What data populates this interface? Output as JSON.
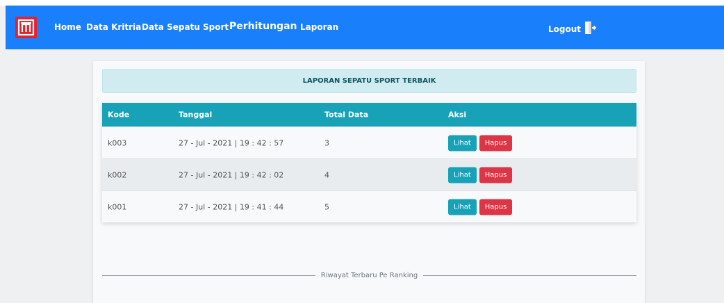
{
  "nav": {
    "home": "Home",
    "kriteria": "Data Kritria",
    "sepatu": "Data Sepatu Sport",
    "perhitungan": "Perhitungan",
    "laporan": "Laporan",
    "logout": "Logout"
  },
  "report": {
    "title": "LAPORAN SEPATU SPORT TERBAIK",
    "columns": [
      "Kode",
      "Tanggal",
      "Total Data",
      "Aksi"
    ],
    "rows": [
      {
        "kode": "k003",
        "tanggal": "27 - Jul - 2021 | 19 : 42 : 57",
        "total": "3",
        "lihat": "Lihat",
        "hapus": "Hapus"
      },
      {
        "kode": "k002",
        "tanggal": "27 - Jul - 2021 | 19 : 42 : 02",
        "total": "4",
        "lihat": "Lihat",
        "hapus": "Hapus"
      },
      {
        "kode": "k001",
        "tanggal": "27 - Jul - 2021 | 19 : 41 : 44",
        "total": "5",
        "lihat": "Lihat",
        "hapus": "Hapus"
      }
    ]
  },
  "divider_text": "Riwayat Terbaru Pe Ranking",
  "icons": {
    "brand": "brand-logo-icon",
    "logout": "logout-door-icon"
  },
  "colors": {
    "navbar": "#1a7ffb",
    "brand": "#e1232d",
    "table_header": "#17a2b8",
    "lihat": "#17a2b8",
    "hapus": "#dc3545",
    "alert_bg": "#d1ecf1"
  }
}
